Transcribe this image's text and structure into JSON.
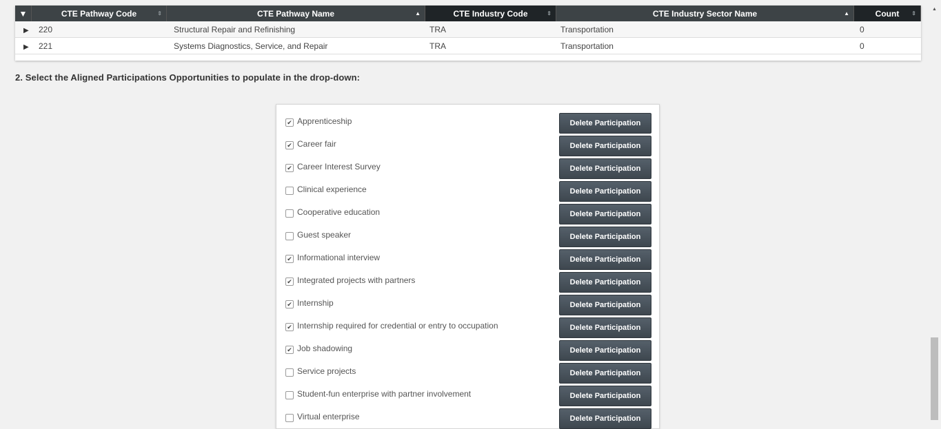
{
  "grid": {
    "collapse_glyph": "▼",
    "sort_neutral_glyph": "⇕",
    "sort_asc_glyph": "▲",
    "columns": [
      {
        "label": "CTE Pathway Code",
        "sort": "none"
      },
      {
        "label": "CTE Pathway Name",
        "sort": "asc"
      },
      {
        "label": "CTE Industry Code",
        "sort": "none"
      },
      {
        "label": "CTE Industry Sector Name",
        "sort": "asc"
      },
      {
        "label": "Count",
        "sort": "none"
      }
    ],
    "rows": [
      {
        "code": "220",
        "name": "Structural Repair and Refinishing",
        "industry_code": "TRA",
        "sector": "Transportation",
        "count": "0"
      },
      {
        "code": "221",
        "name": "Systems Diagnostics, Service, and Repair",
        "industry_code": "TRA",
        "sector": "Transportation",
        "count": "0"
      }
    ]
  },
  "instruction": "2. Select the Aligned Participations Opportunities to populate in the drop-down:",
  "participations": {
    "button_label": "Delete Participation",
    "check_glyph": "✔",
    "items": [
      {
        "label": "Apprenticeship",
        "checked": true
      },
      {
        "label": "Career fair",
        "checked": true
      },
      {
        "label": "Career Interest Survey",
        "checked": true
      },
      {
        "label": "Clinical experience",
        "checked": false
      },
      {
        "label": "Cooperative education",
        "checked": false
      },
      {
        "label": "Guest speaker",
        "checked": false
      },
      {
        "label": "Informational interview",
        "checked": true
      },
      {
        "label": "Integrated projects with partners",
        "checked": true
      },
      {
        "label": "Internship",
        "checked": true
      },
      {
        "label": "Internship required for credential or entry to occupation",
        "checked": true
      },
      {
        "label": "Job shadowing",
        "checked": true
      },
      {
        "label": "Service projects",
        "checked": false
      },
      {
        "label": "Student-fun enterprise with partner involvement",
        "checked": false
      },
      {
        "label": "Virtual enterprise",
        "checked": false
      }
    ]
  },
  "scrollbar": {
    "up_arrow": "▲"
  },
  "colors": {
    "header_bg": "#3d4346",
    "button_bg": "#4a545c",
    "page_bg": "#f1f1f1"
  }
}
